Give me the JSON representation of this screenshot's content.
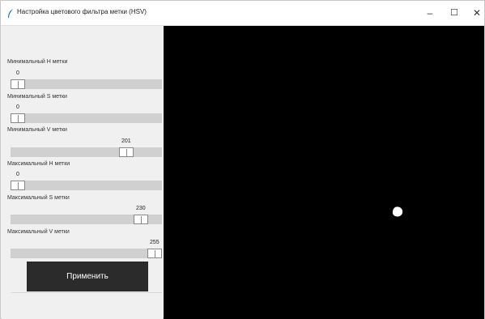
{
  "window": {
    "title": "Настройка цветового фильтра метки (HSV)",
    "controls": {
      "minimize": "–",
      "maximize": "☐",
      "close": "✕"
    }
  },
  "sliders": [
    {
      "label": "Минимальный H метки",
      "value": "0",
      "fraction": 0.0
    },
    {
      "label": "Минимальный S метки",
      "value": "0",
      "fraction": 0.0
    },
    {
      "label": "Минимальный V метки",
      "value": "201",
      "fraction": 0.79
    },
    {
      "label": "Максимальный H метки",
      "value": "0",
      "fraction": 0.0
    },
    {
      "label": "Максимальный S метки",
      "value": "230",
      "fraction": 0.9
    },
    {
      "label": "Максимальный V метки",
      "value": "255",
      "fraction": 1.0
    }
  ],
  "apply_button": {
    "label": "Применить"
  },
  "preview": {
    "background": "#000000",
    "mask_color": "#ffffff"
  }
}
